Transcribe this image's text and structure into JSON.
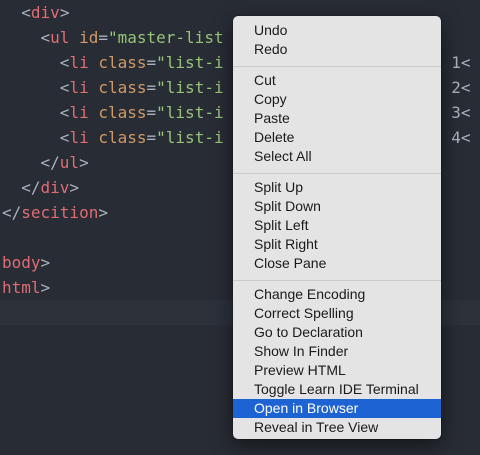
{
  "editor": {
    "lines": [
      {
        "indent": "  ",
        "parts": [
          [
            "punct",
            "<"
          ],
          [
            "tag",
            "div"
          ],
          [
            "punct",
            ">"
          ]
        ]
      },
      {
        "indent": "    ",
        "parts": [
          [
            "punct",
            "<"
          ],
          [
            "tag",
            "ul"
          ],
          [
            "punct",
            " "
          ],
          [
            "attr",
            "id"
          ],
          [
            "punct",
            "="
          ],
          [
            "str",
            "\"master-list"
          ]
        ]
      },
      {
        "indent": "      ",
        "parts": [
          [
            "punct",
            "<"
          ],
          [
            "tag",
            "li"
          ],
          [
            "punct",
            " "
          ],
          [
            "attr",
            "class"
          ],
          [
            "punct",
            "="
          ],
          [
            "str",
            "\"list-i"
          ]
        ],
        "tail": "m 1<"
      },
      {
        "indent": "      ",
        "parts": [
          [
            "punct",
            "<"
          ],
          [
            "tag",
            "li"
          ],
          [
            "punct",
            " "
          ],
          [
            "attr",
            "class"
          ],
          [
            "punct",
            "="
          ],
          [
            "str",
            "\"list-i"
          ]
        ],
        "tail": "m 2<"
      },
      {
        "indent": "      ",
        "parts": [
          [
            "punct",
            "<"
          ],
          [
            "tag",
            "li"
          ],
          [
            "punct",
            " "
          ],
          [
            "attr",
            "class"
          ],
          [
            "punct",
            "="
          ],
          [
            "str",
            "\"list-i"
          ]
        ],
        "tail": "m 3<"
      },
      {
        "indent": "      ",
        "parts": [
          [
            "punct",
            "<"
          ],
          [
            "tag",
            "li"
          ],
          [
            "punct",
            " "
          ],
          [
            "attr",
            "class"
          ],
          [
            "punct",
            "="
          ],
          [
            "str",
            "\"list-i"
          ]
        ],
        "tail": "m 4<"
      },
      {
        "indent": "    ",
        "parts": [
          [
            "punct",
            "</"
          ],
          [
            "tag",
            "ul"
          ],
          [
            "punct",
            ">"
          ]
        ]
      },
      {
        "indent": "  ",
        "parts": [
          [
            "punct",
            "</"
          ],
          [
            "tag",
            "div"
          ],
          [
            "punct",
            ">"
          ]
        ]
      },
      {
        "indent": "",
        "parts": [
          [
            "punct",
            "</"
          ],
          [
            "tag",
            "secition"
          ],
          [
            "punct",
            ">"
          ]
        ]
      },
      {
        "indent": "",
        "parts": []
      },
      {
        "indent": "",
        "parts": [
          [
            "tag",
            "body"
          ],
          [
            "punct",
            ">"
          ]
        ]
      },
      {
        "indent": "",
        "parts": [
          [
            "tag",
            "html"
          ],
          [
            "punct",
            ">"
          ]
        ]
      }
    ]
  },
  "context_menu": {
    "groups": [
      {
        "items": [
          "Undo",
          "Redo"
        ]
      },
      {
        "items": [
          "Cut",
          "Copy",
          "Paste",
          "Delete",
          "Select All"
        ]
      },
      {
        "items": [
          "Split Up",
          "Split Down",
          "Split Left",
          "Split Right",
          "Close Pane"
        ]
      },
      {
        "items": [
          "Change Encoding",
          "Correct Spelling",
          "Go to Declaration",
          "Show In Finder",
          "Preview HTML",
          "Toggle Learn IDE Terminal",
          "Open in Browser",
          "Reveal in Tree View"
        ]
      }
    ],
    "active_item": "Open in Browser"
  },
  "colors": {
    "editor_bg": "#282c34",
    "tag": "#e06c75",
    "attr": "#d19a66",
    "string": "#98c379",
    "menu_bg": "#e4e4e4",
    "menu_highlight": "#1e63d4"
  }
}
